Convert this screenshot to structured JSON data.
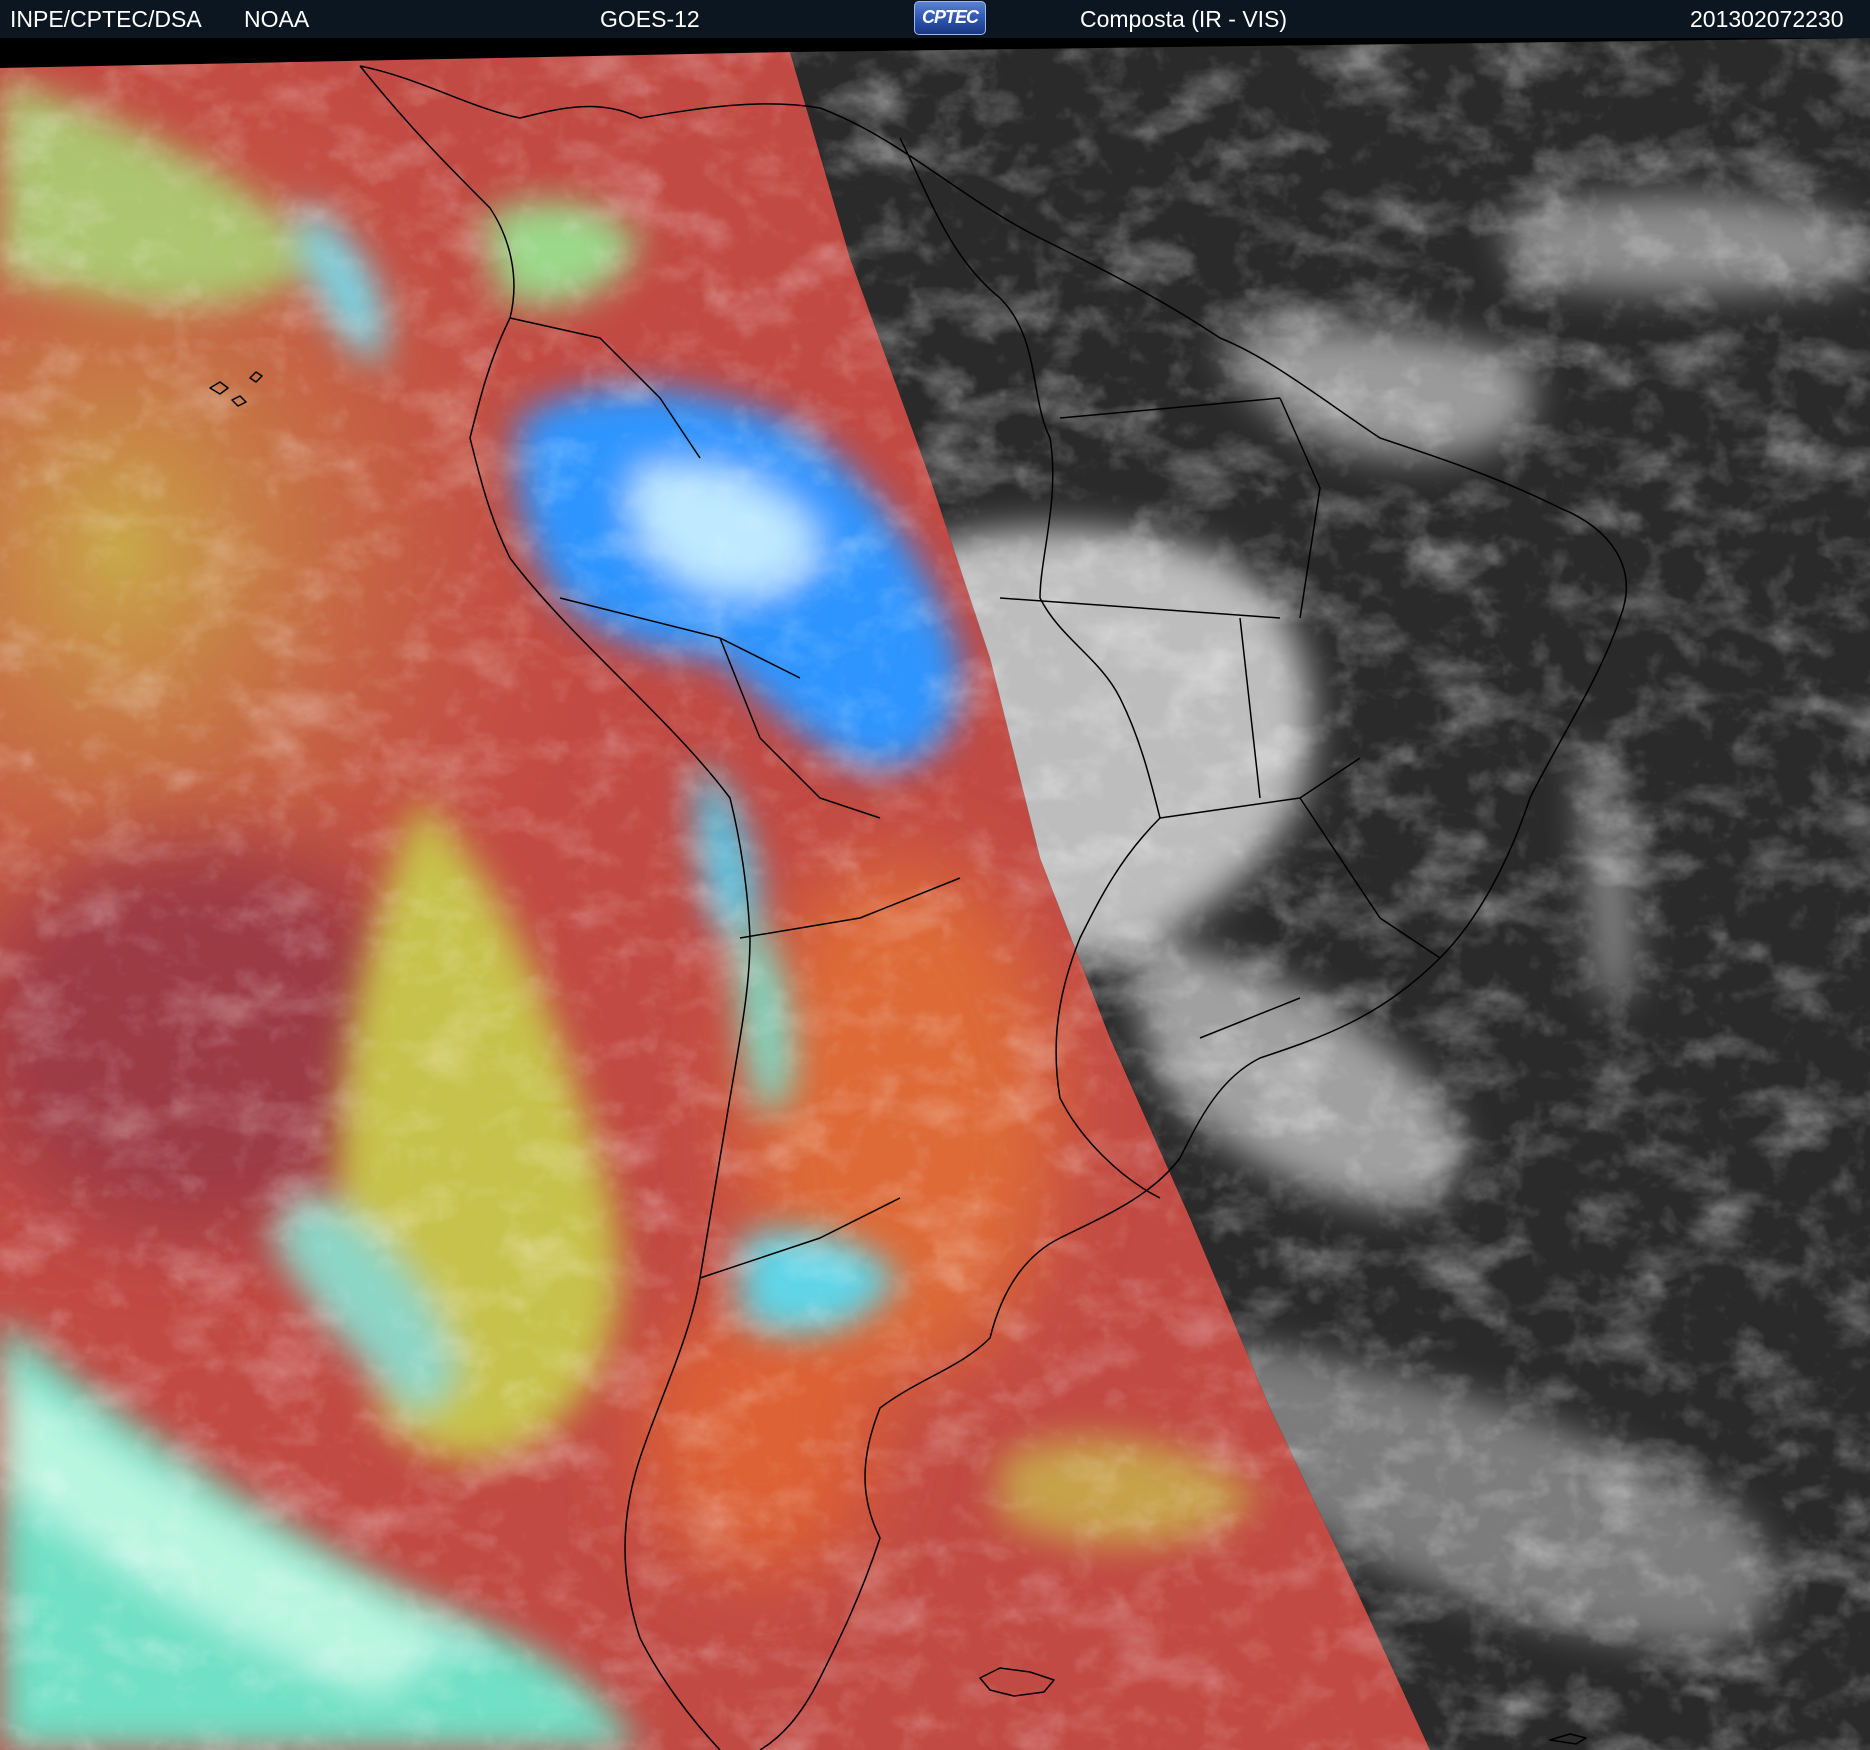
{
  "header": {
    "agency": "INPE/CPTEC/DSA",
    "provider": "NOAA",
    "satellite": "GOES-12",
    "logo_text": "CPTEC",
    "product": "Composta (IR - VIS)",
    "datetime": "201302072230"
  },
  "colors": {
    "header_bg": "#0b1620",
    "ir_red": "#c8453e",
    "ir_orange": "#d96a3a",
    "ir_yellow": "#c9c24a",
    "ir_green": "#8fd37a",
    "ir_cyan": "#55e0d0",
    "ir_blue": "#2f8cff",
    "vis_dark": "#2a2a2a",
    "vis_cloud": "#d0d0d0"
  }
}
